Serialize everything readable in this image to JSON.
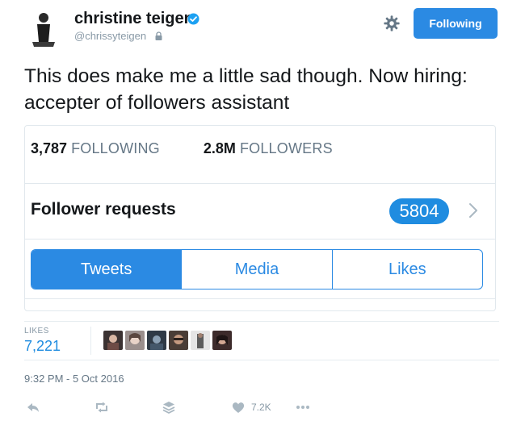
{
  "profile": {
    "name": "christine teigen",
    "handle": "@chrissyteigen",
    "follow_button_label": "Following"
  },
  "tweet": {
    "text": "This does make me a little sad though. Now hiring: accepter of followers assistant"
  },
  "card": {
    "following_count": "3,787",
    "following_label": "FOLLOWING",
    "followers_count": "2.8M",
    "followers_label": "FOLLOWERS",
    "requests_label": "Follower requests",
    "requests_count": "5804",
    "tabs": [
      {
        "label": "Tweets",
        "active": true
      },
      {
        "label": "Media",
        "active": false
      },
      {
        "label": "Likes",
        "active": false
      }
    ]
  },
  "engagement": {
    "likes_label": "LIKES",
    "likes_count": "7,221",
    "liker_avatar_count": 6
  },
  "meta": {
    "timestamp": "9:32 PM - 5 Oct 2016"
  },
  "actions": {
    "like_count": "7.2K"
  },
  "colors": {
    "accent": "#1DA1F2",
    "button_blue": "#2b8ae3",
    "text_primary": "#14171a",
    "text_secondary": "#657786"
  }
}
